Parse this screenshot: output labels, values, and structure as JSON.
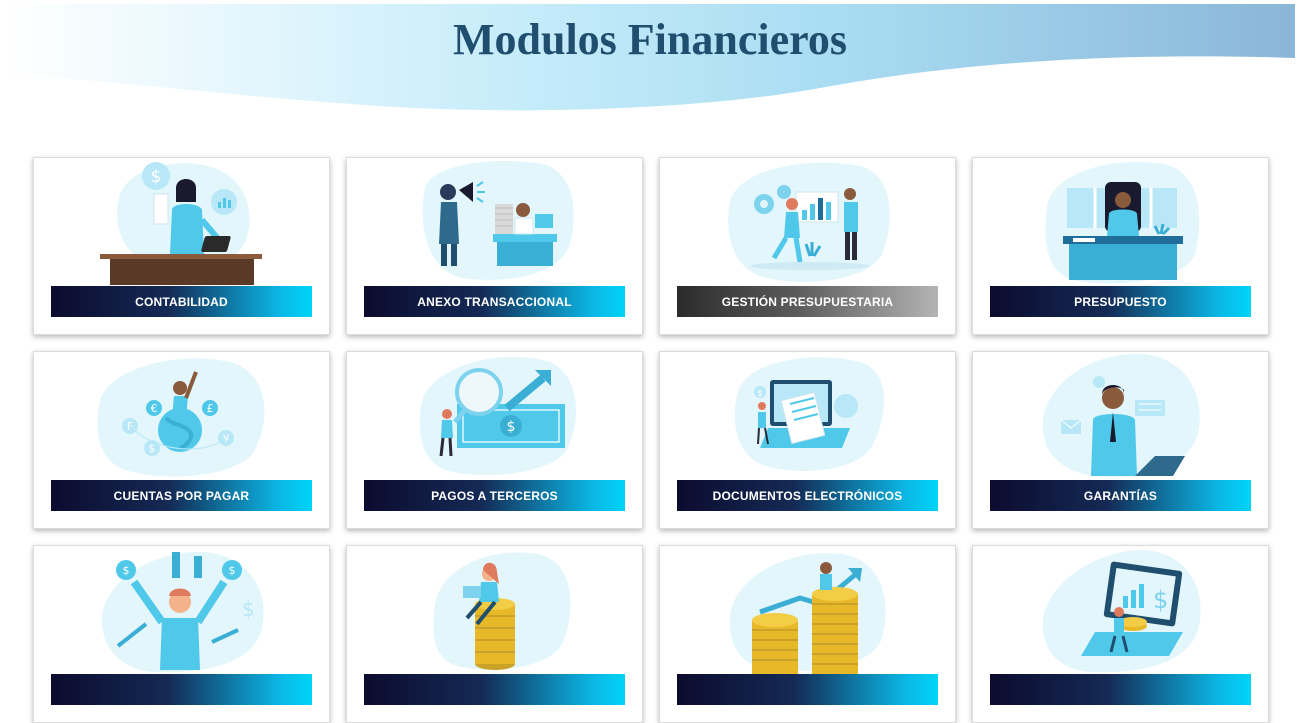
{
  "header": {
    "title": "Modulos Financieros"
  },
  "modules": [
    {
      "label": "CONTABILIDAD",
      "icon": "accountant-illustration-icon"
    },
    {
      "label": "ANEXO TRANSACCIONAL",
      "icon": "megaphone-office-illustration-icon"
    },
    {
      "label": "GESTIÓN PRESUPUESTARIA",
      "icon": "budget-chart-team-illustration-icon",
      "style": "grey"
    },
    {
      "label": "PRESUPUESTO",
      "icon": "executive-desk-illustration-icon"
    },
    {
      "label": "CUENTAS POR PAGAR",
      "icon": "currency-globe-illustration-icon"
    },
    {
      "label": "PAGOS A TERCEROS",
      "icon": "banknote-magnifier-illustration-icon"
    },
    {
      "label": "DOCUMENTOS ELECTRÓNICOS",
      "icon": "laptop-documents-illustration-icon"
    },
    {
      "label": "GARANTÍAS",
      "icon": "businessman-laptop-illustration-icon"
    },
    {
      "label": "",
      "icon": "money-bags-celebration-illustration-icon"
    },
    {
      "label": "",
      "icon": "person-on-coins-illustration-icon"
    },
    {
      "label": "",
      "icon": "coin-stacks-growth-illustration-icon"
    },
    {
      "label": "",
      "icon": "laptop-coins-chart-illustration-icon"
    }
  ],
  "colors": {
    "title": "#1f4e6e",
    "label_gradient_start": "#0c0b2e",
    "label_gradient_end": "#00d4f7",
    "label_grey_start": "#2b2b2b",
    "illustration_blob": "#e2f6fc",
    "illustration_accent": "#4fc8ea"
  }
}
